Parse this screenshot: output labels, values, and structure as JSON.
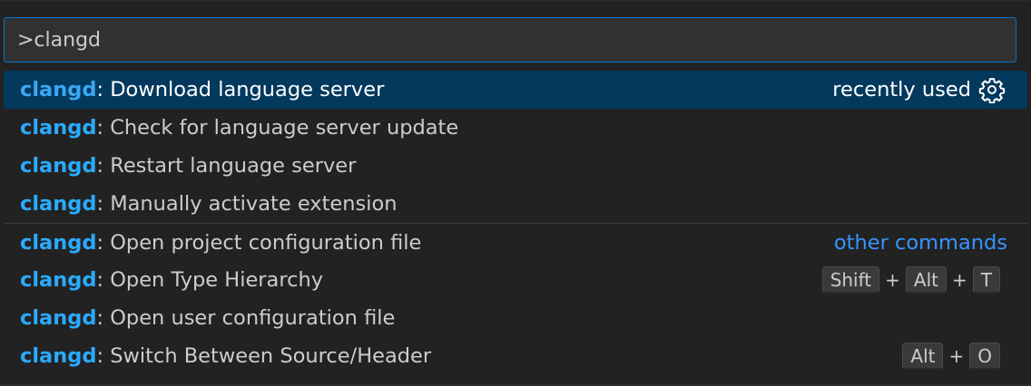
{
  "input": {
    "value": ">clangd"
  },
  "items": [
    {
      "prefix": "clangd",
      "text": ": Download language server",
      "right": "recently used",
      "selected": true
    },
    {
      "prefix": "clangd",
      "text": ": Check for language server update"
    },
    {
      "prefix": "clangd",
      "text": ": Restart language server"
    },
    {
      "prefix": "clangd",
      "text": ": Manually activate extension"
    },
    {
      "prefix": "clangd",
      "text": ": Open project configuration file",
      "group": "other commands"
    },
    {
      "prefix": "clangd",
      "text": ": Open Type Hierarchy",
      "keys": [
        "Shift",
        "Alt",
        "T"
      ]
    },
    {
      "prefix": "clangd",
      "text": ": Open user configuration file"
    },
    {
      "prefix": "clangd",
      "text": ": Switch Between Source/Header",
      "keys": [
        "Alt",
        "O"
      ]
    }
  ],
  "keybinding_separator": "+",
  "icons": {
    "configure": "gear-icon"
  },
  "colors": {
    "highlight": "#2aaaff",
    "selection_bg": "#04395e",
    "focus_border": "#0078d4",
    "link": "#3794ff"
  }
}
